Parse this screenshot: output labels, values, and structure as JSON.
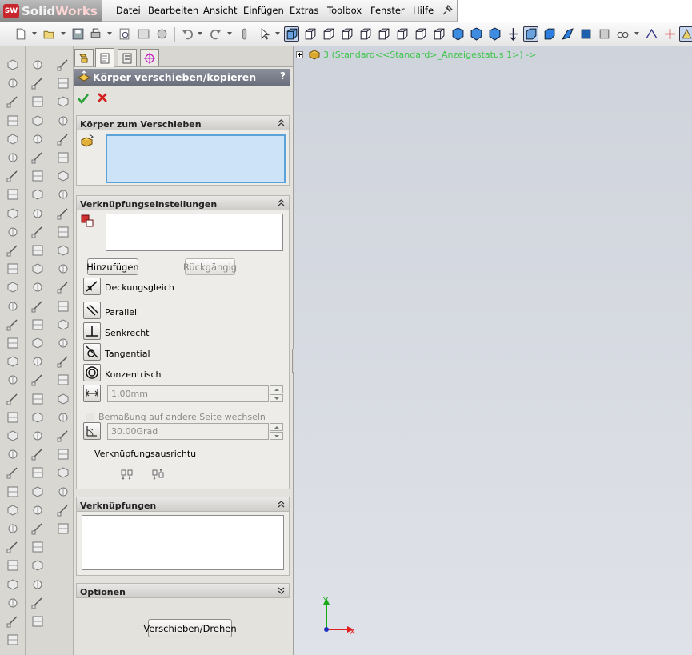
{
  "app": {
    "brand_prefix": "Solid",
    "brand_suffix": "Works",
    "logo_badge": "SW"
  },
  "menu": [
    "Datei",
    "Bearbeiten",
    "Ansicht",
    "Einfügen",
    "Extras",
    "Toolbox",
    "Fenster",
    "Hilfe"
  ],
  "property_manager": {
    "title": "Körper verschieben/kopieren",
    "help": "?",
    "groups": {
      "bodies": {
        "title": "Körper zum Verschieben"
      },
      "mate_settings": {
        "title": "Verknüpfungseinstellungen",
        "add_label": "Hinzufügen",
        "undo_label": "Rückgängig",
        "mates": {
          "coincident": "Deckungsgleich",
          "parallel": "Parallel",
          "perpendicular": "Senkrecht",
          "tangent": "Tangential",
          "concentric": "Konzentrisch"
        },
        "distance_value": "1.00mm",
        "flip_dimension_label": "Bemaßung auf andere Seite wechseln",
        "angle_value": "30.00Grad",
        "alignment_label": "Verknüpfungsausrichtu"
      },
      "mates": {
        "title": "Verknüpfungen"
      },
      "options": {
        "title": "Optionen",
        "move_rotate_label": "Verschieben/Drehen"
      }
    }
  },
  "feature_tree": {
    "item": "3  (Standard<<Standard>_Anzeigestatus 1>) ->"
  },
  "triad": {
    "x_label": "X",
    "y_label": "Y"
  },
  "colors": {
    "accent": "#5aa3d8",
    "titlebar": "#7a7d8a",
    "tree_text": "#3cc64a"
  }
}
